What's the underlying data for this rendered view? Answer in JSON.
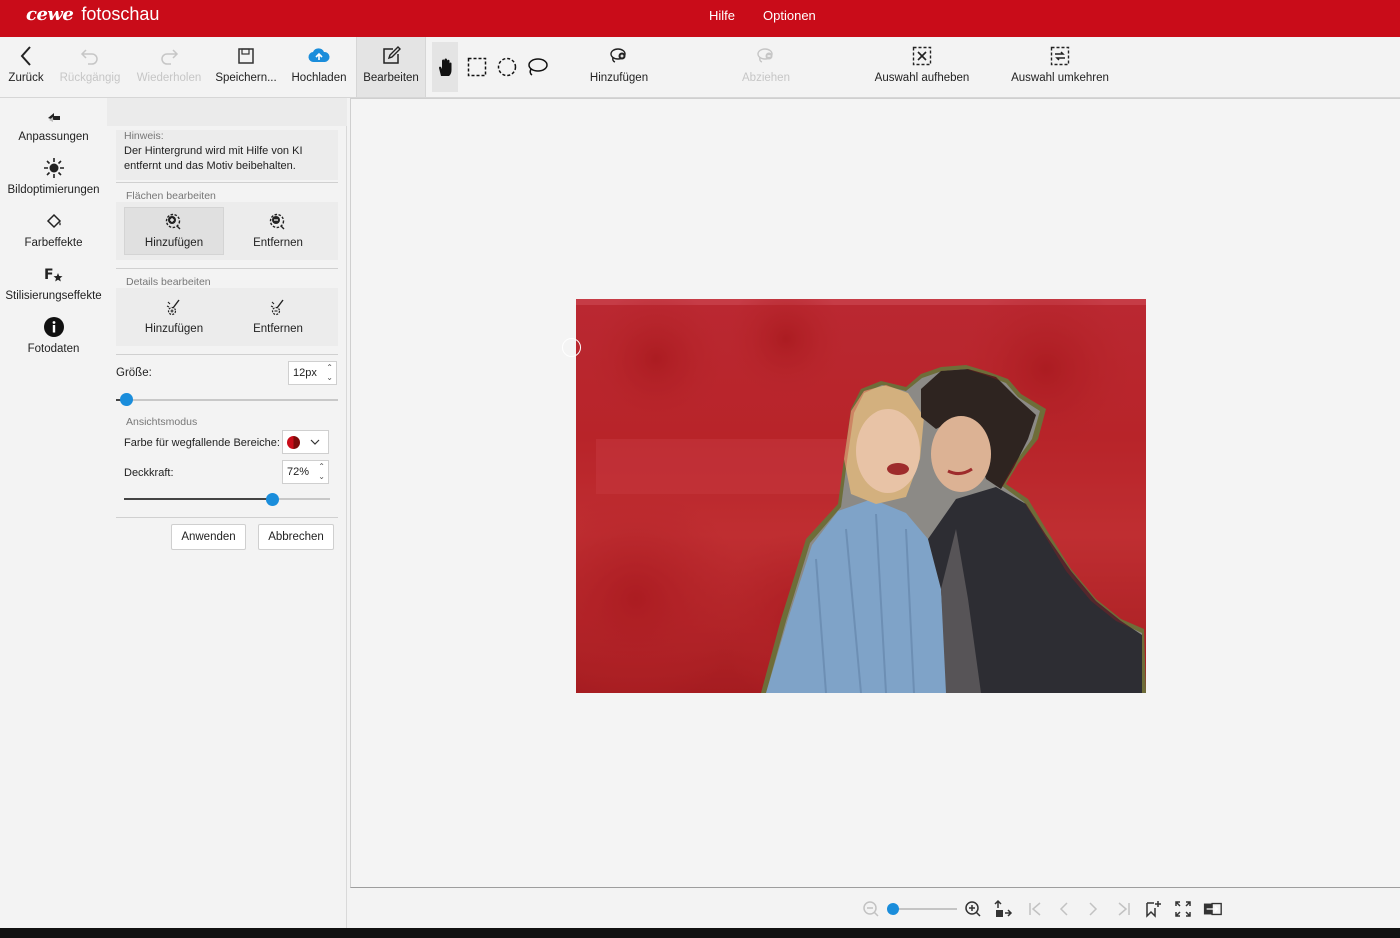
{
  "titlebar": {
    "logo": "cewe",
    "app_name": "fotoschau",
    "menu": [
      {
        "label": "Hilfe"
      },
      {
        "label": "Optionen"
      }
    ]
  },
  "toolbar": {
    "back": "Zurück",
    "undo": "Rückgängig",
    "redo": "Wiederholen",
    "save": "Speichern...",
    "upload": "Hochladen",
    "edit": "Bearbeiten",
    "add": "Hinzufügen",
    "subtract": "Abziehen",
    "clear_selection": "Auswahl aufheben",
    "invert_selection": "Auswahl umkehren"
  },
  "rail": [
    {
      "label": "Anpassungen",
      "icon": "adjustments-icon"
    },
    {
      "label": "Bildoptimierungen",
      "icon": "sun-icon"
    },
    {
      "label": "Farbeffekte",
      "icon": "paint-bucket-icon"
    },
    {
      "label": "Stilisierungseffekte",
      "icon": "fx-icon"
    },
    {
      "label": "Fotodaten",
      "icon": "info-icon"
    }
  ],
  "panel": {
    "hint_caption": "Hinweis:",
    "hint_text_line1": "Der Hintergrund wird mit Hilfe von KI",
    "hint_text_line2": "entfernt und das Motiv beibehalten.",
    "areas_caption": "Flächen bearbeiten",
    "areas_add": "Hinzufügen",
    "areas_remove": "Entfernen",
    "details_caption": "Details bearbeiten",
    "details_add": "Hinzufügen",
    "details_remove": "Entfernen",
    "size_label": "Größe:",
    "size_value": "12px",
    "size_slider_fraction": 0.05,
    "view_caption": "Ansichtsmodus",
    "color_label": "Farbe für wegfallende Bereiche:",
    "opacity_label": "Deckkraft:",
    "opacity_value": "72%",
    "opacity_fraction": 0.72,
    "apply": "Anwenden",
    "cancel": "Abbrechen"
  },
  "colors": {
    "brand": "#c90c19",
    "accent": "#1a8ddb",
    "overlay": "#c0161e"
  }
}
